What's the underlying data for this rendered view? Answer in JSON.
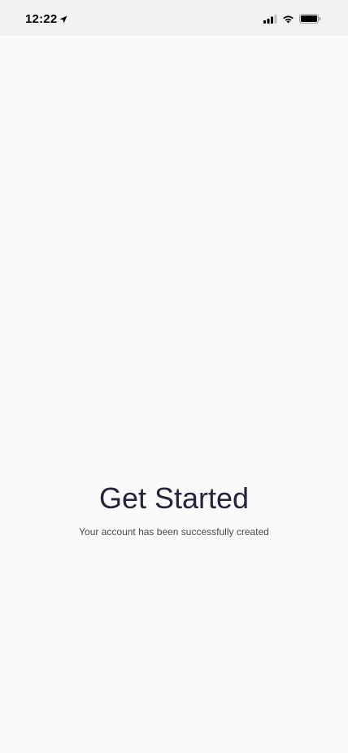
{
  "status_bar": {
    "time": "12:22",
    "icons": [
      "location-arrow-icon",
      "signal-icon",
      "wifi-icon",
      "battery-icon"
    ]
  },
  "main": {
    "title": "Get Started",
    "subtitle": "Your account has been successfully created"
  },
  "colors": {
    "background": "#fafafa",
    "status_bar_bg": "#f2f2f2",
    "title_text": "#24243a",
    "subtitle_text": "#4a4a4a"
  }
}
